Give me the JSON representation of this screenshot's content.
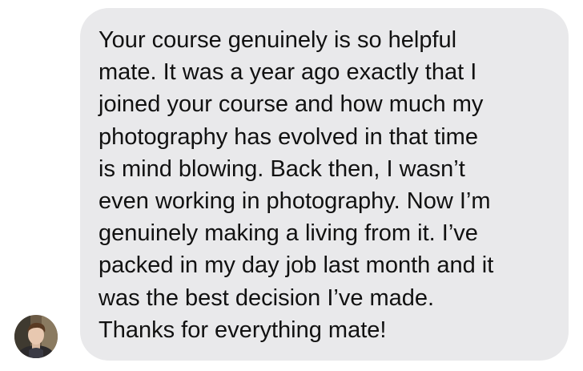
{
  "message": {
    "sender_avatar": "profile-photo",
    "lines": [
      "Your course genuinely is so helpful",
      "mate. It was a year ago exactly that I",
      "joined your course and how much my",
      "photography has evolved in that time",
      "is mind blowing. Back then, I wasn’t",
      "even working in photography. Now I’m",
      "genuinely making a living from it. I’ve",
      "packed in my day job last month and it",
      "was the best decision I’ve made.",
      "Thanks for everything mate!"
    ]
  },
  "colors": {
    "bubble": "#e9e9eb",
    "text": "#111111",
    "background": "#ffffff"
  }
}
